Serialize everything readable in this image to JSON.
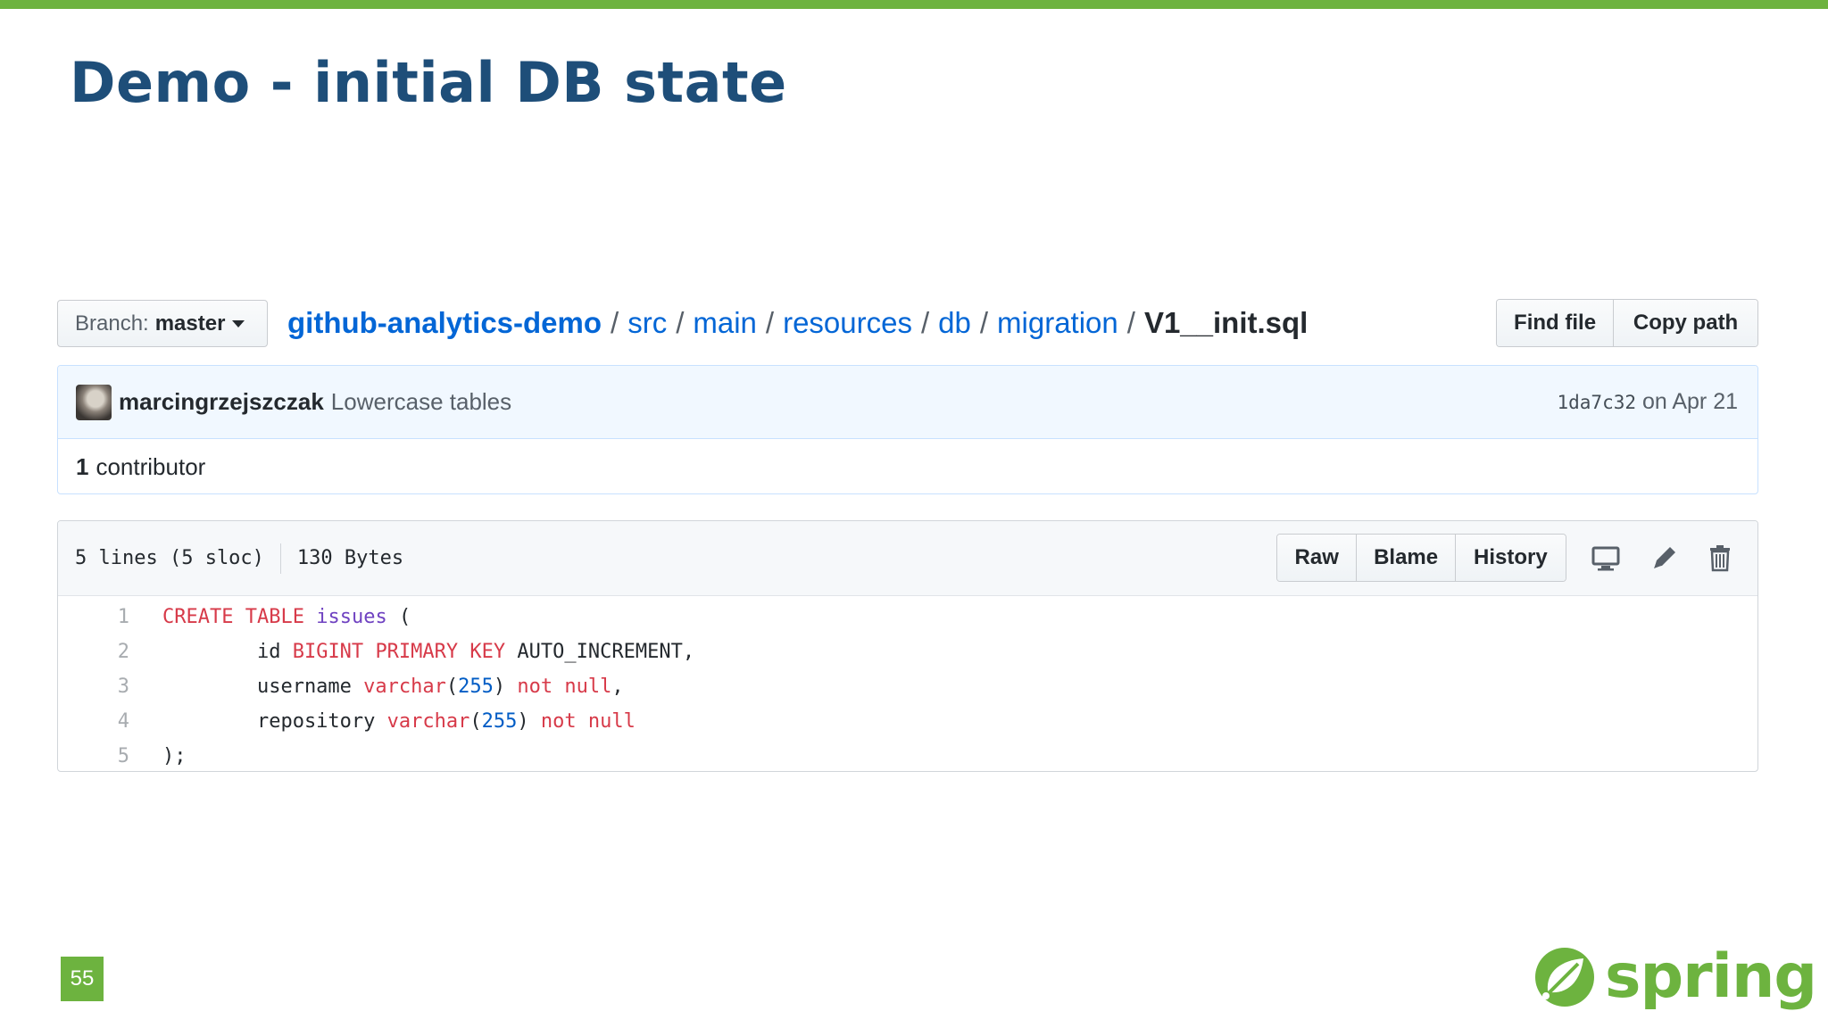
{
  "slide": {
    "title": "Demo - initial DB state",
    "page_number": "55",
    "logo_text": "spring",
    "accent_color": "#6db33f",
    "title_color": "#1e4e79"
  },
  "file_nav": {
    "branch_label": "Branch:",
    "branch_value": "master",
    "breadcrumb": [
      "github-analytics-demo",
      "src",
      "main",
      "resources",
      "db",
      "migration"
    ],
    "separator": "/",
    "file_name": "V1__init.sql",
    "find_file_label": "Find file",
    "copy_path_label": "Copy path"
  },
  "commit": {
    "author": "marcingrzejszczak",
    "message": "Lowercase tables",
    "sha": "1da7c32",
    "date": "on Apr 21",
    "contributors_count": "1",
    "contributors_label": "contributor"
  },
  "file": {
    "lines_info": "5 lines (5 sloc)",
    "size": "130 Bytes",
    "raw_label": "Raw",
    "blame_label": "Blame",
    "history_label": "History",
    "icons": [
      "desktop-icon",
      "pencil-icon",
      "trash-icon"
    ],
    "code_lines": [
      {
        "number": "1",
        "tokens": [
          {
            "t": "CREATE",
            "c": "kw"
          },
          {
            "t": " "
          },
          {
            "t": "TABLE",
            "c": "kw"
          },
          {
            "t": " "
          },
          {
            "t": "issues",
            "c": "ent"
          },
          {
            "t": " ("
          }
        ]
      },
      {
        "number": "2",
        "tokens": [
          {
            "t": "        id "
          },
          {
            "t": "BIGINT",
            "c": "kw"
          },
          {
            "t": " "
          },
          {
            "t": "PRIMARY KEY",
            "c": "kw"
          },
          {
            "t": " AUTO_INCREMENT,"
          }
        ]
      },
      {
        "number": "3",
        "tokens": [
          {
            "t": "        username "
          },
          {
            "t": "varchar",
            "c": "kw"
          },
          {
            "t": "("
          },
          {
            "t": "255",
            "c": "num"
          },
          {
            "t": ") "
          },
          {
            "t": "not null",
            "c": "kw"
          },
          {
            "t": ","
          }
        ]
      },
      {
        "number": "4",
        "tokens": [
          {
            "t": "        repository "
          },
          {
            "t": "varchar",
            "c": "kw"
          },
          {
            "t": "("
          },
          {
            "t": "255",
            "c": "num"
          },
          {
            "t": ") "
          },
          {
            "t": "not null",
            "c": "kw"
          }
        ]
      },
      {
        "number": "5",
        "tokens": [
          {
            "t": ");"
          }
        ]
      }
    ]
  }
}
